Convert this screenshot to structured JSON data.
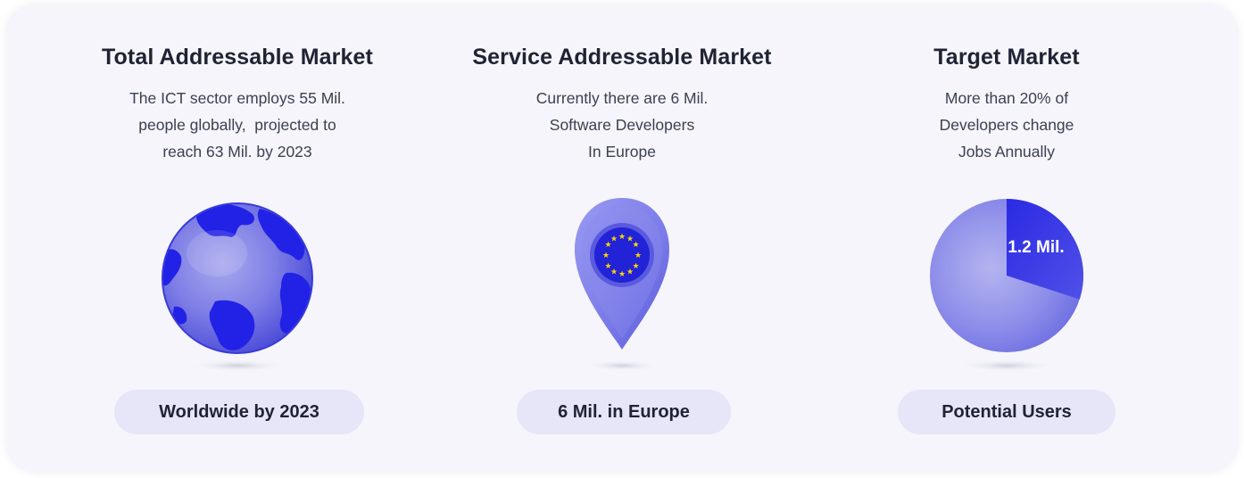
{
  "colors": {
    "card_background": "#f5f5fb",
    "pill_background": "#e6e6f8",
    "accent_blue": "#2222e6",
    "soft_purple": "#8a8af0",
    "eu_star_yellow": "#ffd700"
  },
  "markets": [
    {
      "title": "Total Addressable Market",
      "description_lines": [
        "The ICT sector employs 55 Mil.",
        "people globally,  projected to",
        "reach 63 Mil. by 2023"
      ],
      "graphic_icon": "globe-icon",
      "badge": "Worldwide by 2023"
    },
    {
      "title": "Service Addressable Market",
      "description_lines": [
        "Currently there are 6 Mil.",
        "Software Developers",
        "In Europe"
      ],
      "graphic_icon": "eu-location-pin-icon",
      "badge": "6 Mil. in Europe"
    },
    {
      "title": "Target Market",
      "description_lines": [
        "More than 20% of",
        "Developers change",
        "Jobs Annually"
      ],
      "graphic_icon": "pie-chart-icon",
      "pie_label": "1.2 Mil.",
      "pie_slice_percent": 20,
      "badge": "Potential Users"
    }
  ]
}
